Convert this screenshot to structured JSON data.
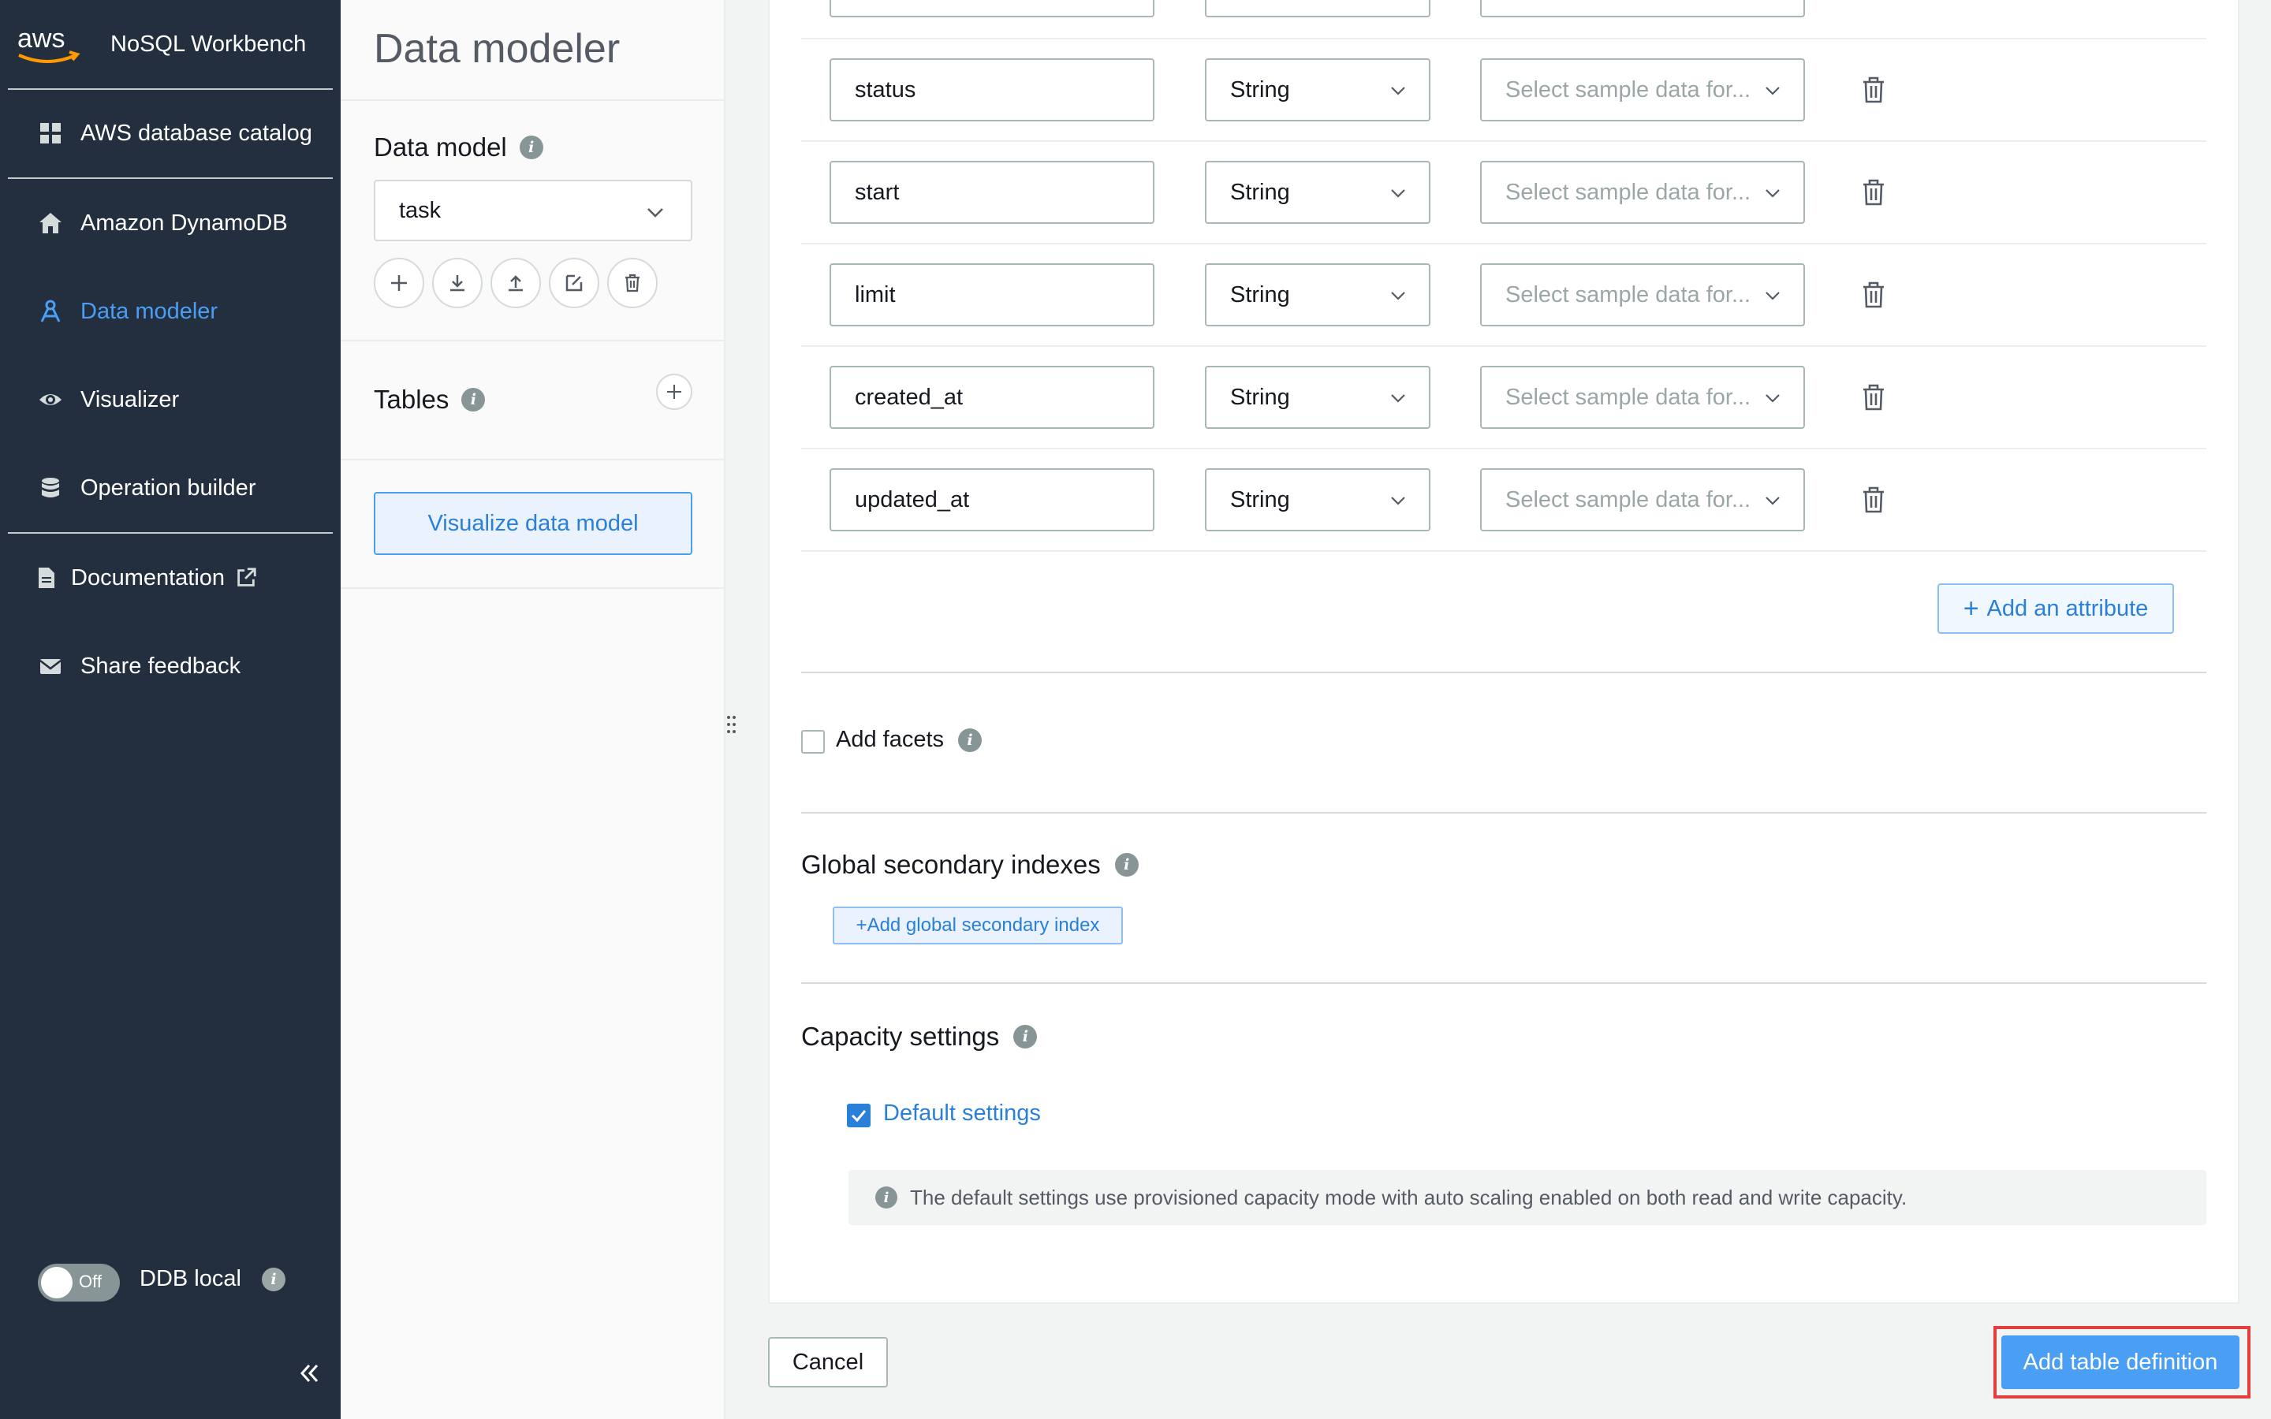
{
  "app": {
    "name": "NoSQL Workbench",
    "logo_icon": "aws-logo-icon"
  },
  "sidebar": {
    "items": [
      {
        "label": "AWS database catalog",
        "icon": "grid-icon"
      },
      {
        "label": "Amazon DynamoDB",
        "icon": "home-icon"
      },
      {
        "label": "Data modeler",
        "icon": "data-modeler-icon",
        "active": true
      },
      {
        "label": "Visualizer",
        "icon": "eye-icon"
      },
      {
        "label": "Operation builder",
        "icon": "database-icon"
      },
      {
        "label": "Documentation",
        "icon": "document-icon",
        "external_icon": "external-link-icon"
      },
      {
        "label": "Share feedback",
        "icon": "envelope-icon"
      }
    ],
    "ddb_local": {
      "toggle_text": "Off",
      "label": "DDB local",
      "info": "i"
    }
  },
  "modeler": {
    "title": "Data modeler",
    "data_model_label": "Data model",
    "info": "i",
    "selected_model": "task",
    "tables_label": "Tables",
    "visualize_label": "Visualize data model"
  },
  "attributes": [
    {
      "name": "",
      "type": "",
      "sample": ""
    },
    {
      "name": "status",
      "type": "String",
      "sample": "Select sample data for..."
    },
    {
      "name": "start",
      "type": "String",
      "sample": "Select sample data for..."
    },
    {
      "name": "limit",
      "type": "String",
      "sample": "Select sample data for..."
    },
    {
      "name": "created_at",
      "type": "String",
      "sample": "Select sample data for..."
    },
    {
      "name": "updated_at",
      "type": "String",
      "sample": "Select sample data for..."
    }
  ],
  "form": {
    "add_attribute": "Add an attribute",
    "add_facets": "Add facets",
    "gsi_heading": "Global secondary indexes",
    "add_gsi": "+Add global secondary index",
    "capacity_heading": "Capacity settings",
    "default_settings": "Default settings",
    "capacity_note": "The default settings use provisioned capacity mode with auto scaling enabled on both read and write capacity.",
    "info": "i"
  },
  "footer": {
    "cancel": "Cancel",
    "submit": "Add table definition"
  },
  "colors": {
    "sidebar_bg": "#232f3e",
    "accent": "#4a9ff5",
    "highlight": "#e53c3c"
  }
}
